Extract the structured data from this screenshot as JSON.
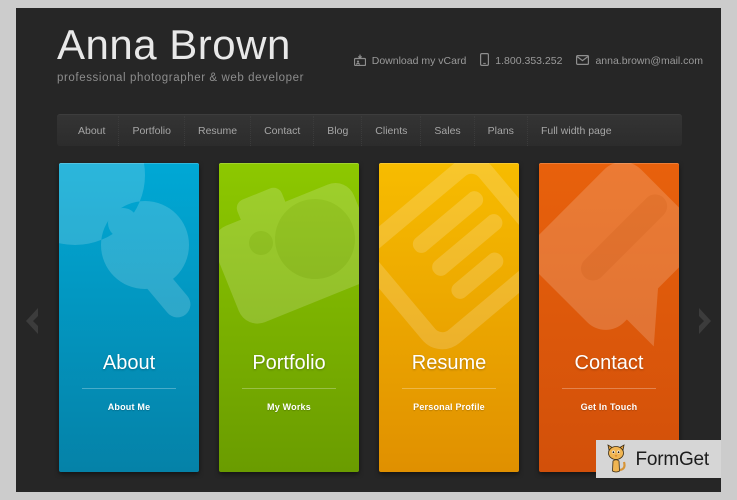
{
  "theme": {
    "page_bg": "#262626",
    "frame_bg": "#cccccc",
    "nav_bg": "#2e2e2e",
    "text_muted": "#9a9a9a"
  },
  "header": {
    "brand_name": "Anna Brown",
    "tagline": "professional photographer & web developer",
    "contact": [
      {
        "icon": "vcard-download-icon",
        "label": "Download my vCard"
      },
      {
        "icon": "phone-icon",
        "label": "1.800.353.252"
      },
      {
        "icon": "mail-icon",
        "label": "anna.brown@mail.com"
      }
    ]
  },
  "nav": {
    "items": [
      {
        "label": "About"
      },
      {
        "label": "Portfolio"
      },
      {
        "label": "Resume"
      },
      {
        "label": "Contact"
      },
      {
        "label": "Blog"
      },
      {
        "label": "Clients"
      },
      {
        "label": "Sales"
      },
      {
        "label": "Plans"
      },
      {
        "label": "Full width page"
      }
    ]
  },
  "cards": [
    {
      "title": "About",
      "subtitle": "About Me",
      "icon": "magnifier-icon",
      "color_top": "#00a8d5",
      "color_bottom": "#0582a8"
    },
    {
      "title": "Portfolio",
      "subtitle": "My Works",
      "icon": "camera-icon",
      "color_top": "#8dc800",
      "color_bottom": "#6a9c00"
    },
    {
      "title": "Resume",
      "subtitle": "Personal Profile",
      "icon": "document-list-icon",
      "color_top": "#f7bc00",
      "color_bottom": "#e09000"
    },
    {
      "title": "Contact",
      "subtitle": "Get In Touch",
      "icon": "speech-bubble-icon",
      "color_top": "#e8610c",
      "color_bottom": "#d2500a"
    }
  ],
  "slider": {
    "prev_label": "Previous",
    "next_label": "Next"
  },
  "watermark": {
    "brand": "FormGet",
    "icon": "cat-mascot-icon",
    "bg": "#d6d6d6"
  }
}
